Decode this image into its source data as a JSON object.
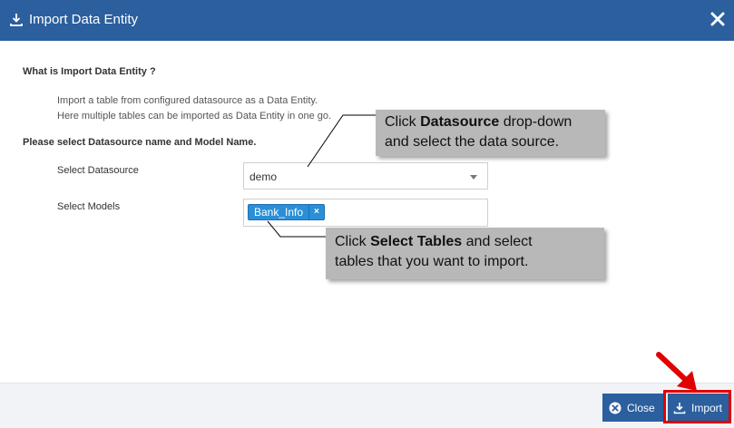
{
  "dialog": {
    "title": "Import Data Entity",
    "header_color": "#2b5f9e"
  },
  "content": {
    "question1": "What is Import Data Entity ?",
    "description_line1": "Import a table from configured datasource as a Data Entity.",
    "description_line2": "Here multiple tables can be imported as Data Entity in one go.",
    "question2": "Please select Datasource name and Model Name.",
    "datasource_label": "Select Datasource",
    "datasource_value": "demo",
    "models_label": "Select Models",
    "selected_models": [
      {
        "label": "Bank_Info",
        "remove": "×"
      }
    ]
  },
  "callouts": {
    "datasource": {
      "prefix": "Click ",
      "bold": "Datasource",
      "suffix": " drop-down",
      "line2": "and select the data source."
    },
    "tables": {
      "prefix": "Click ",
      "bold": "Select Tables",
      "suffix": " and select",
      "line2": "tables that you want to import."
    }
  },
  "footer": {
    "close_label": "Close",
    "import_label": "Import"
  },
  "colors": {
    "accent": "#2b5f9e",
    "tag": "#2a8fd6",
    "highlight": "#e00000",
    "callout_bg": "#b8b8b8"
  },
  "icons": {
    "title": "download-icon",
    "close": "close-icon",
    "close_button": "times-circle-icon",
    "import_button": "download-icon"
  }
}
